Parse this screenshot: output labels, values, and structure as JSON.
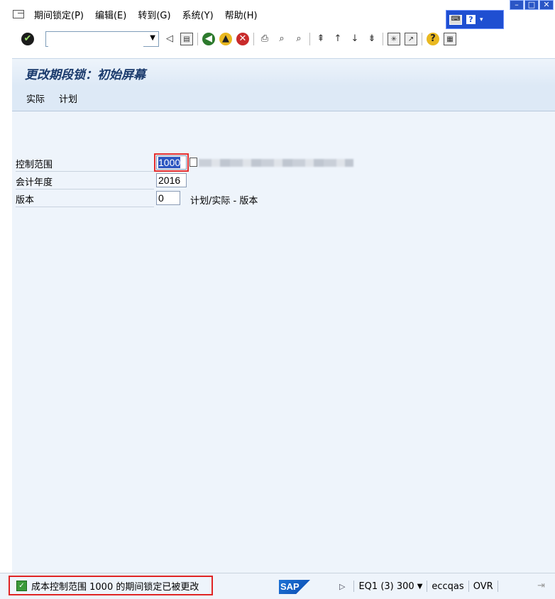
{
  "menu": {
    "items": [
      "期间锁定(P)",
      "编辑(E)",
      "转到(G)",
      "系统(Y)",
      "帮助(H)"
    ]
  },
  "toolbar": {
    "command_field_value": "",
    "icons": [
      "enter-icon",
      "back-icon",
      "save-icon",
      "back-nav-icon",
      "exit-icon",
      "cancel-icon",
      "print-icon",
      "find-icon",
      "find-next-icon",
      "first-page-icon",
      "prev-page-icon",
      "next-page-icon",
      "last-page-icon",
      "new-session-icon",
      "shortcut-icon",
      "help-icon",
      "layout-icon"
    ]
  },
  "title": "更改期段锁：初始屏幕",
  "app_toolbar": {
    "actual": "实际",
    "plan": "计划"
  },
  "form": {
    "controlling_area_label": "控制范围",
    "controlling_area_value": "1000",
    "fiscal_year_label": "会计年度",
    "fiscal_year_value": "2016",
    "version_label": "版本",
    "version_value": "0",
    "version_text": "计划/实际 - 版本"
  },
  "status": {
    "message": "成本控制范围 1000 的期间锁定已被更改",
    "system": "EQ1 (3) 300",
    "server": "eccqas",
    "mode": "OVR",
    "logo": "SAP"
  },
  "colors": {
    "accent_blue": "#1f4fd1",
    "highlight_red": "#e02424",
    "background": "#eef4fb"
  }
}
